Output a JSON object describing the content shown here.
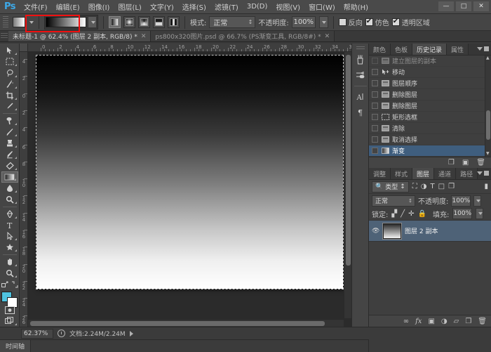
{
  "app": {
    "logo": "Ps",
    "title": "Adobe Photoshop"
  },
  "window_controls": {
    "minimize": "—",
    "maximize": "□",
    "close": "✕"
  },
  "menubar": {
    "items": [
      {
        "label": "文件(F)"
      },
      {
        "label": "编辑(E)"
      },
      {
        "label": "图像(I)"
      },
      {
        "label": "图层(L)"
      },
      {
        "label": "文字(Y)"
      },
      {
        "label": "选择(S)"
      },
      {
        "label": "滤镜(T)"
      },
      {
        "label": "3D(D)"
      },
      {
        "label": "视图(V)"
      },
      {
        "label": "窗口(W)"
      },
      {
        "label": "帮助(H)"
      }
    ]
  },
  "options_bar": {
    "tool_preset_name": "gradient-tool-preset",
    "gradient_preset_name": "black-to-white-gradient",
    "gradient_types": [
      {
        "name": "linear-gradient-button",
        "active": true
      },
      {
        "name": "radial-gradient-button",
        "active": false
      },
      {
        "name": "angle-gradient-button",
        "active": false
      },
      {
        "name": "reflected-gradient-button",
        "active": false
      },
      {
        "name": "diamond-gradient-button",
        "active": false
      }
    ],
    "mode_label": "模式:",
    "mode_value": "正常",
    "opacity_label": "不透明度:",
    "opacity_value": "100%",
    "reverse_label": "反向",
    "reverse_checked": false,
    "dither_label": "仿色",
    "dither_checked": true,
    "transparency_label": "透明区域",
    "transparency_checked": true
  },
  "document_tabs": [
    {
      "label": "未标题-1 @ 62.4% (图层 2 副本, RGB/8) *",
      "active": true,
      "close": "✕"
    },
    {
      "label": "ps800x320图片.psd @ 66.7% (PS渐变工具, RGB/8#) *",
      "active": false,
      "close": "✕"
    }
  ],
  "toolbar": {
    "tools": [
      {
        "name": "move-tool",
        "glyph": "⮚"
      },
      {
        "name": "rectangular-marquee-tool",
        "glyph": "⬚"
      },
      {
        "name": "lasso-tool",
        "glyph": "⌀"
      },
      {
        "name": "magic-wand-tool",
        "glyph": "✳"
      },
      {
        "name": "crop-tool",
        "glyph": "⌗"
      },
      {
        "name": "eyedropper-tool",
        "glyph": "✒"
      },
      {
        "name": "spot-healing-brush-tool",
        "glyph": "❁"
      },
      {
        "name": "brush-tool",
        "glyph": "╱"
      },
      {
        "name": "clone-stamp-tool",
        "glyph": "✇"
      },
      {
        "name": "history-brush-tool",
        "glyph": "✎"
      },
      {
        "name": "eraser-tool",
        "glyph": "◧"
      },
      {
        "name": "gradient-tool",
        "glyph": "▤",
        "active": true
      },
      {
        "name": "blur-tool",
        "glyph": "◖"
      },
      {
        "name": "dodge-tool",
        "glyph": "⚲"
      },
      {
        "name": "pen-tool",
        "glyph": "✑"
      },
      {
        "name": "horizontal-type-tool",
        "glyph": "T"
      },
      {
        "name": "path-selection-tool",
        "glyph": "➤"
      },
      {
        "name": "custom-shape-tool",
        "glyph": "✶"
      },
      {
        "name": "hand-tool",
        "glyph": "✋"
      },
      {
        "name": "zoom-tool",
        "glyph": "⚲"
      }
    ],
    "swap_colors_name": "swap-colors-icon",
    "default_colors_name": "default-colors-icon",
    "foreground_color": "#4fc3e0",
    "background_color": "#ffffff",
    "quick_mask_name": "quick-mask-button",
    "screen_mode_name": "screen-mode-button"
  },
  "rulers": {
    "horizontal_ticks": [
      "0",
      "2",
      "4",
      "6",
      "8",
      "10",
      "12",
      "14",
      "16",
      "18",
      "20",
      "22",
      "24",
      "26",
      "28",
      "30",
      "32",
      "34",
      "36"
    ],
    "vertical_ticks": [
      "4",
      "2",
      "0",
      "2",
      "4",
      "6",
      "8",
      "10",
      "12",
      "14",
      "16",
      "18",
      "20",
      "22",
      "24",
      "26",
      "28"
    ]
  },
  "canvas": {
    "name": "document-canvas",
    "gradient_from": "#000000",
    "gradient_to": "#ffffff",
    "direction": "top-to-bottom"
  },
  "dock_strip": {
    "icons": [
      {
        "name": "brush-panel-icon",
        "glyph": "🖌"
      },
      {
        "name": "brush-presets-panel-icon",
        "glyph": "✒"
      },
      {
        "name": "character-panel-icon",
        "glyph": "A"
      },
      {
        "name": "paragraph-panel-icon",
        "glyph": "¶"
      }
    ]
  },
  "history_panel": {
    "tabs": [
      {
        "label": "颜色",
        "active": false
      },
      {
        "label": "色板",
        "active": false
      },
      {
        "label": "历史记录",
        "active": true
      },
      {
        "label": "属性",
        "active": false
      }
    ],
    "states": [
      {
        "label": "建立图层的副本",
        "icon": "layer-icon",
        "selected": false,
        "partial": true
      },
      {
        "label": "移动",
        "icon": "move-icon",
        "selected": false
      },
      {
        "label": "图层顺序",
        "icon": "layer-icon",
        "selected": false
      },
      {
        "label": "删除图层",
        "icon": "layer-icon",
        "selected": false
      },
      {
        "label": "删除图层",
        "icon": "layer-icon",
        "selected": false
      },
      {
        "label": "矩形选框",
        "icon": "marquee-icon",
        "selected": false
      },
      {
        "label": "清除",
        "icon": "layer-icon",
        "selected": false
      },
      {
        "label": "取消选择",
        "icon": "layer-icon",
        "selected": false
      },
      {
        "label": "渐变",
        "icon": "gradient-icon",
        "selected": true
      }
    ],
    "footer_icons": [
      {
        "name": "create-document-from-state-icon",
        "glyph": "❐"
      },
      {
        "name": "create-new-snapshot-icon",
        "glyph": "▣"
      },
      {
        "name": "delete-state-icon",
        "glyph": "🗑"
      }
    ]
  },
  "layers_panel": {
    "tabs": [
      {
        "label": "调整",
        "active": false
      },
      {
        "label": "样式",
        "active": false
      },
      {
        "label": "图层",
        "active": true
      },
      {
        "label": "通道",
        "active": false
      },
      {
        "label": "路径",
        "active": false
      }
    ],
    "filter_label": "类型",
    "filter_icons": [
      {
        "name": "filter-pixel-icon",
        "glyph": "⛶"
      },
      {
        "name": "filter-adjustment-icon",
        "glyph": "◑"
      },
      {
        "name": "filter-type-icon",
        "glyph": "T"
      },
      {
        "name": "filter-shape-icon",
        "glyph": "□"
      },
      {
        "name": "filter-smart-object-icon",
        "glyph": "❐"
      }
    ],
    "blend_mode": "正常",
    "opacity_label": "不透明度:",
    "opacity_value": "100%",
    "lock_label": "锁定:",
    "lock_icons": [
      {
        "name": "lock-transparent-pixels-icon",
        "glyph": "▞"
      },
      {
        "name": "lock-image-pixels-icon",
        "glyph": "╱"
      },
      {
        "name": "lock-position-icon",
        "glyph": "✛"
      },
      {
        "name": "lock-all-icon",
        "glyph": "🔒"
      }
    ],
    "fill_label": "填充:",
    "fill_value": "100%",
    "layers": [
      {
        "name": "图层 2 副本",
        "visible": true,
        "selected": true
      }
    ],
    "footer_icons": [
      {
        "name": "link-layers-icon",
        "glyph": "∞"
      },
      {
        "name": "layer-style-icon",
        "glyph": "fx"
      },
      {
        "name": "add-layer-mask-icon",
        "glyph": "▣"
      },
      {
        "name": "new-fill-adjustment-layer-icon",
        "glyph": "◑"
      },
      {
        "name": "new-group-icon",
        "glyph": "▱"
      },
      {
        "name": "new-layer-icon",
        "glyph": "❐"
      },
      {
        "name": "delete-layer-icon",
        "glyph": "🗑"
      }
    ]
  },
  "status_bar": {
    "zoom": "62.37%",
    "doc_info": "文档:2.24M/2.24M",
    "timeline_tab": "时间轴"
  },
  "annotation": {
    "color": "#f01010",
    "name": "gradient-preset-highlight"
  }
}
